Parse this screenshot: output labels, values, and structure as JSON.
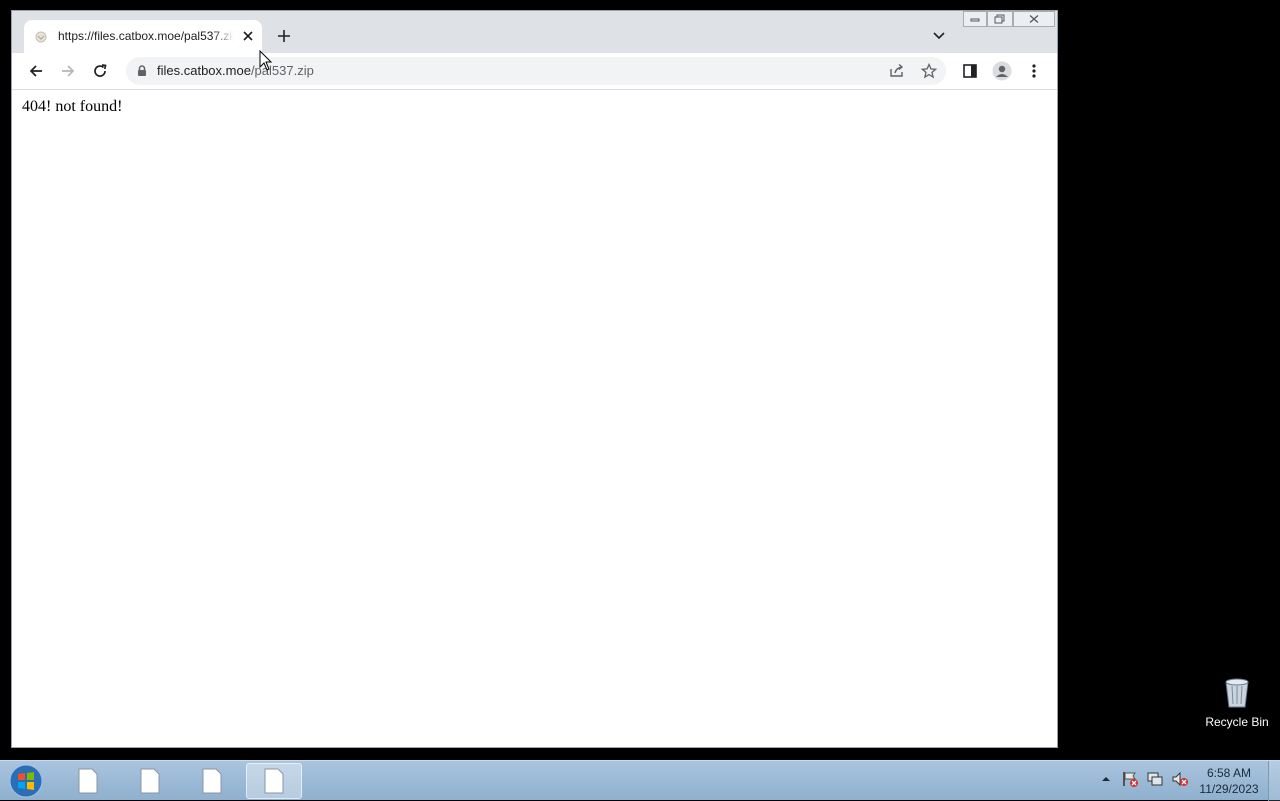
{
  "browser": {
    "tab": {
      "title": "https://files.catbox.moe/pal537.zip"
    },
    "address_bar": {
      "host": "files.catbox.moe",
      "path": "/pal537.zip"
    }
  },
  "page": {
    "text": "404! not found!"
  },
  "desktop": {
    "recycle_bin_label": "Recycle Bin"
  },
  "taskbar": {
    "time": "6:58 AM",
    "date": "11/29/2023"
  },
  "colors": {
    "accent_tabstrip": "#dee1e6",
    "taskbar": "#a9c4de"
  }
}
